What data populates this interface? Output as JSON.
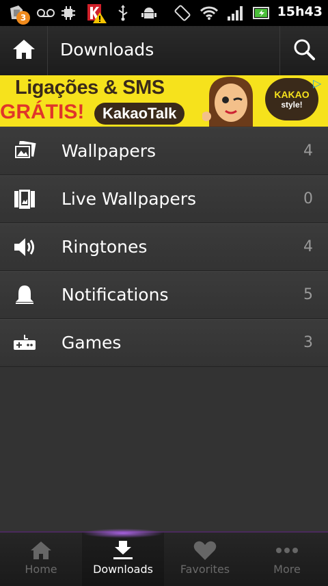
{
  "statusbar": {
    "time": "15h43",
    "badge_count": "3",
    "icons": [
      "app-notification-icon",
      "voicemail-icon",
      "cpu-icon",
      "kaspersky-warning-icon",
      "usb-icon",
      "android-debug-icon",
      "screen-rotation-icon",
      "wifi-icon",
      "signal-icon",
      "battery-charging-icon"
    ]
  },
  "actionbar": {
    "title": "Downloads",
    "home_icon": "home-icon",
    "search_icon": "search-icon"
  },
  "ad": {
    "line1": "Ligações & SMS",
    "line2": "GRÁTIS!",
    "brand": "KakaoTalk",
    "bubble_top": "KAKAO",
    "bubble_bottom": "style!",
    "info_glyph": "▷"
  },
  "list": {
    "items": [
      {
        "label": "Wallpapers",
        "count": "4",
        "icon": "wallpaper-icon"
      },
      {
        "label": "Live Wallpapers",
        "count": "0",
        "icon": "live-wallpaper-icon"
      },
      {
        "label": "Ringtones",
        "count": "4",
        "icon": "speaker-icon"
      },
      {
        "label": "Notifications",
        "count": "5",
        "icon": "bell-icon"
      },
      {
        "label": "Games",
        "count": "3",
        "icon": "gamepad-icon"
      }
    ]
  },
  "bottomnav": {
    "items": [
      {
        "label": "Home",
        "icon": "home-icon",
        "active": false
      },
      {
        "label": "Downloads",
        "icon": "download-icon",
        "active": true
      },
      {
        "label": "Favorites",
        "icon": "heart-icon",
        "active": false
      },
      {
        "label": "More",
        "icon": "more-dots-icon",
        "active": false
      }
    ]
  },
  "colors": {
    "accent": "#b06eff",
    "ad_background": "#f6e21c",
    "ad_red": "#e0352a"
  }
}
